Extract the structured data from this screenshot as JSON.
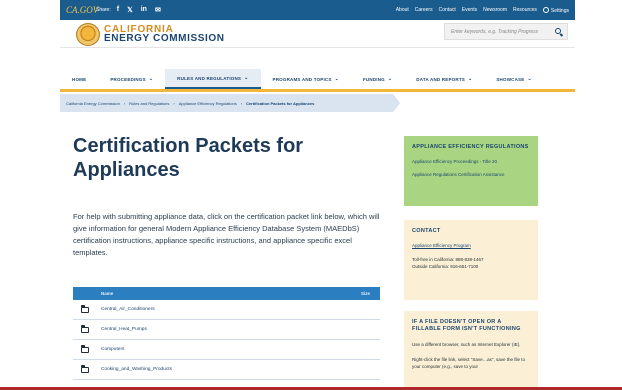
{
  "topbar": {
    "gov_logo": "CA.GOV",
    "share_label": "Share:",
    "social_icons": [
      "facebook-icon",
      "twitter-icon",
      "linkedin-icon",
      "email-icon"
    ],
    "social_glyphs": [
      "f",
      "𝕏",
      "in",
      "✉"
    ],
    "links": [
      "About",
      "Careers",
      "Contact",
      "Events",
      "Newsroom",
      "Resources"
    ],
    "settings_label": "Settings"
  },
  "header": {
    "title_line1": "CALIFORNIA",
    "title_line2": "ENERGY COMMISSION",
    "search_placeholder": "Enter keywords, e.g. Tracking Progress"
  },
  "nav": {
    "items": [
      {
        "label": "HOME",
        "dropdown": false,
        "active": false
      },
      {
        "label": "PROCEEDINGS",
        "dropdown": true,
        "active": false
      },
      {
        "label": "RULES AND REGULATIONS",
        "dropdown": true,
        "active": true
      },
      {
        "label": "PROGRAMS AND TOPICS",
        "dropdown": true,
        "active": false
      },
      {
        "label": "FUNDING",
        "dropdown": true,
        "active": false
      },
      {
        "label": "DATA AND REPORTS",
        "dropdown": true,
        "active": false
      },
      {
        "label": "SHOWCASE",
        "dropdown": true,
        "active": false
      }
    ]
  },
  "breadcrumb": {
    "items": [
      "California Energy Commission",
      "Rules and Regulations",
      "Appliance Efficiency Regulations",
      "Certification Packets for Appliances"
    ]
  },
  "main": {
    "title": "Certification Packets for Appliances",
    "intro": "For help with submitting appliance data, click on the certification packet link below, which will give information for general Modern Appliance Efficiency Database System (MAEDbS) certification instructions, appliance specific instructions, and appliance specific excel templates.",
    "table": {
      "col_name": "Name",
      "col_size": "Size",
      "rows": [
        "Central_Air_Conditioners",
        "Central_Heat_Pumps",
        "Computers",
        "Cooking_and_Washing_Products"
      ]
    }
  },
  "sidebar": {
    "appliance": {
      "heading": "APPLIANCE EFFICIENCY REGULATIONS",
      "links": [
        "Appliance Efficiency Proceedings - Title 20",
        "Appliance Regulations Certification Assistance"
      ]
    },
    "contact": {
      "heading": "CONTACT",
      "link": "Appliance Efficiency Program",
      "phone_line1": "Toll-free in California: 888-838-1467",
      "phone_line2": "Outside California: 916-651-7100"
    },
    "file_help": {
      "heading": "IF A FILE DOESN'T OPEN OR A FILLABLE FORM ISN'T FUNCTIONING",
      "p1": "Use a different browser, such as Internet Explorer (IE).",
      "p2": "Right-click the file link, select \"Save…as\", save the file to your computer (e.g., save to your"
    }
  },
  "colors": {
    "topbar": "#1a5c8e",
    "accent_gold": "#f2b63a",
    "table_header": "#2b7ec0",
    "sidebar_green": "#a9d582",
    "sidebar_cream": "#fbf0d5",
    "title": "#1f3a57"
  }
}
